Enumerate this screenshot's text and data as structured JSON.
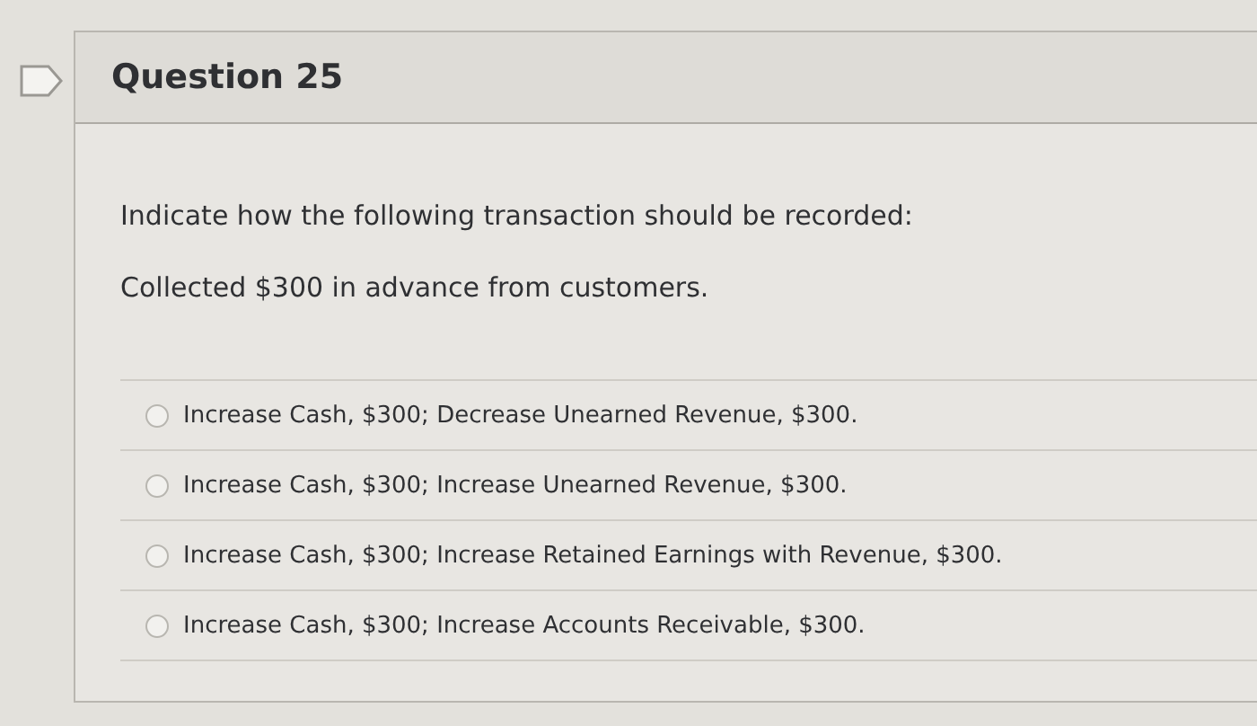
{
  "question": {
    "title": "Question 25",
    "prompt": "Indicate how the following transaction should be recorded:",
    "detail": "Collected $300 in advance from customers.",
    "answers": [
      {
        "label": "Increase Cash, $300; Decrease Unearned Revenue, $300.",
        "selected": false
      },
      {
        "label": "Increase Cash, $300; Increase Unearned Revenue, $300.",
        "selected": false
      },
      {
        "label": "Increase Cash, $300; Increase Retained Earnings with Revenue, $300.",
        "selected": false
      },
      {
        "label": "Increase Cash, $300; Increase Accounts Receivable, $300.",
        "selected": false
      }
    ]
  }
}
